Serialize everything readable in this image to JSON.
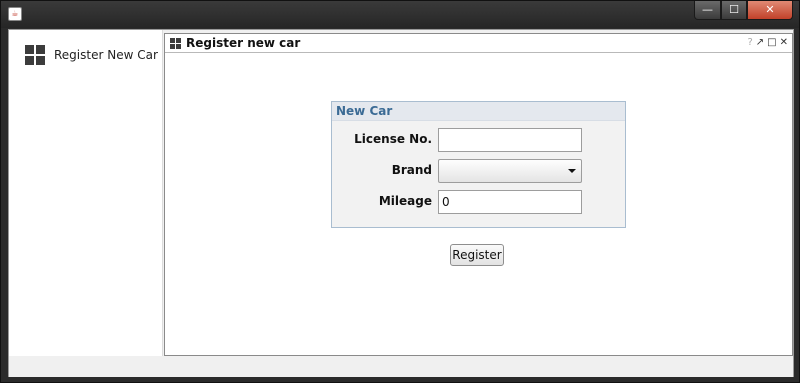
{
  "window": {
    "title": "",
    "app_icon": "java-cup-icon",
    "controls": {
      "minimize_glyph": "—",
      "maximize_glyph": "☐",
      "close_glyph": "✕"
    }
  },
  "sidebar": {
    "items": [
      {
        "label": "Register New Car",
        "icon": "grid-icon"
      }
    ]
  },
  "frame": {
    "title": "Register new car",
    "icon": "grid-icon",
    "controls": {
      "help": "?",
      "detach": "↗",
      "maximize": "□",
      "close": "✕"
    }
  },
  "form": {
    "group_title": "New Car",
    "fields": {
      "license": {
        "label": "License No.",
        "value": ""
      },
      "brand": {
        "label": "Brand",
        "value": ""
      },
      "mileage": {
        "label": "Mileage",
        "value": "0"
      }
    },
    "submit_label": "Register"
  },
  "colors": {
    "group_title": "#3b6b95",
    "group_border": "#a9bdd0",
    "close_button": "#c2412a"
  }
}
